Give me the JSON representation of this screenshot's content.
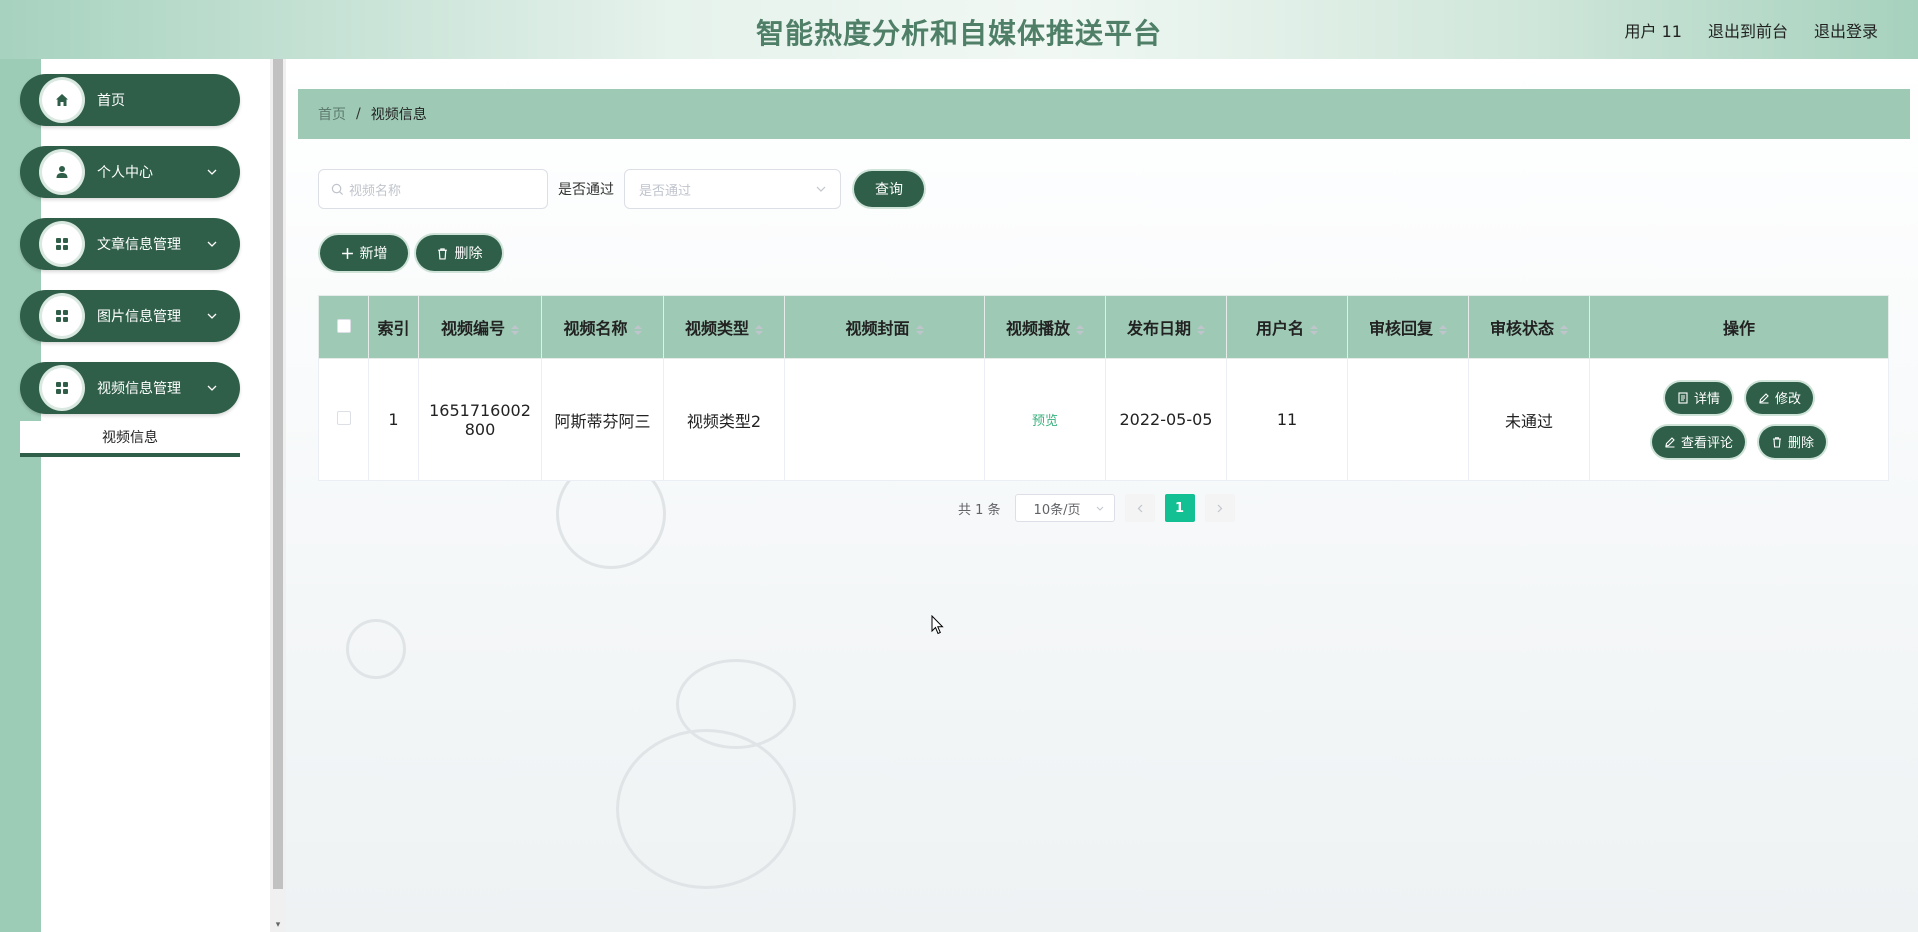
{
  "header": {
    "title": "智能热度分析和自媒体推送平台",
    "user_label": "用户 11",
    "front_label": "退出到前台",
    "logout_label": "退出登录"
  },
  "sidebar": {
    "items": [
      {
        "label": "首页",
        "icon": "home-icon"
      },
      {
        "label": "个人中心",
        "icon": "user-icon"
      },
      {
        "label": "文章信息管理",
        "icon": "grid-icon"
      },
      {
        "label": "图片信息管理",
        "icon": "grid-icon"
      },
      {
        "label": "视频信息管理",
        "icon": "grid-icon"
      }
    ],
    "submenu": {
      "label": "视频信息"
    }
  },
  "breadcrumb": {
    "home": "首页",
    "separator": "/",
    "current": "视频信息"
  },
  "search": {
    "name_placeholder": "视频名称",
    "filter_label": "是否通过",
    "filter_placeholder": "是否通过",
    "query_label": "查询"
  },
  "actions": {
    "add_label": "新增",
    "delete_label": "删除"
  },
  "table": {
    "columns": [
      "索引",
      "视频编号",
      "视频名称",
      "视频类型",
      "视频封面",
      "视频播放",
      "发布日期",
      "用户名",
      "审核回复",
      "审核状态",
      "操作"
    ],
    "rows": [
      {
        "index": "1",
        "video_no": "1651716002800",
        "video_name": "阿斯蒂芬阿三",
        "video_type": "视频类型2",
        "cover": "",
        "play": "预览",
        "date": "2022-05-05",
        "username": "11",
        "reply": "",
        "status": "未通过",
        "ops": {
          "detail": "详情",
          "edit": "修改",
          "comments": "查看评论",
          "delete": "删除"
        }
      }
    ]
  },
  "pagination": {
    "total": "共 1 条",
    "page_size": "10条/页",
    "current_page": "1"
  },
  "colors": {
    "primary": "#2f5f49",
    "header_green": "#9ecab5",
    "page_active": "#13c093"
  }
}
